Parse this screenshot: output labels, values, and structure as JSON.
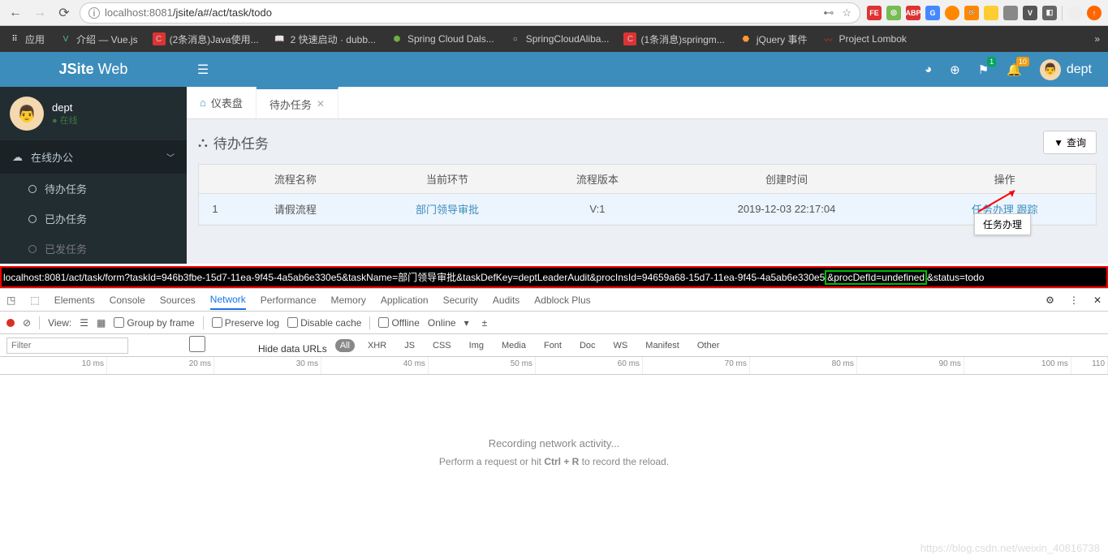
{
  "browser": {
    "url_host": "localhost",
    "url_port": ":8081",
    "url_path": "/jsite/a#/act/task/todo",
    "key_icon": "⊷",
    "star_icon": "☆"
  },
  "bookmarks": {
    "apps": "应用",
    "items": [
      {
        "label": "介绍 — Vue.js"
      },
      {
        "label": "(2条消息)Java使用..."
      },
      {
        "label": "2 快速启动 · dubb..."
      },
      {
        "label": "Spring Cloud Dals..."
      },
      {
        "label": "SpringCloudAliba..."
      },
      {
        "label": "(1条消息)springm..."
      },
      {
        "label": "jQuery 事件"
      },
      {
        "label": "Project Lombok"
      }
    ]
  },
  "app": {
    "logo_bold": "JSite",
    "logo_light": " Web",
    "badges": {
      "flag": "1",
      "bell": "10"
    },
    "user": "dept"
  },
  "sidebar": {
    "user": {
      "name": "dept",
      "status": "在线"
    },
    "menu_header": "在线办公",
    "items": [
      {
        "label": "待办任务"
      },
      {
        "label": "已办任务"
      },
      {
        "label": "已发任务"
      }
    ]
  },
  "tabs": {
    "dashboard": "仪表盘",
    "todo": "待办任务"
  },
  "page": {
    "title": "待办任务",
    "query_btn": "查询"
  },
  "table": {
    "headers": [
      "",
      "流程名称",
      "当前环节",
      "流程版本",
      "创建时间",
      "操作"
    ],
    "row": {
      "idx": "1",
      "name": "请假流程",
      "step": "部门领导审批",
      "ver": "V:1",
      "time": "2019-12-03 22:17:04",
      "op1": "任务办理",
      "op2": "跟踪"
    },
    "tooltip": "任务办理"
  },
  "highlight_url": {
    "part1": "localhost:8081/act/task/form?taskId=946b3fbe-15d7-11ea-9f45-4a5ab6e330e5&taskName=部门领导审批&taskDefKey=deptLeaderAudit&procInsId=94659a68-15d7-11ea-9f45-4a5ab6e330e5",
    "green": "&procDefId=undefined",
    "part2": "&status=todo"
  },
  "devtools": {
    "tabs": [
      "Elements",
      "Console",
      "Sources",
      "Network",
      "Performance",
      "Memory",
      "Application",
      "Security",
      "Audits",
      "Adblock Plus"
    ],
    "toolbar": {
      "view": "View:",
      "group": "Group by frame",
      "preserve": "Preserve log",
      "disable": "Disable cache",
      "offline": "Offline",
      "online": "Online"
    },
    "filter_placeholder": "Filter",
    "hide_urls": "Hide data URLs",
    "filter_pills": [
      "All",
      "XHR",
      "JS",
      "CSS",
      "Img",
      "Media",
      "Font",
      "Doc",
      "WS",
      "Manifest",
      "Other"
    ],
    "timeline": [
      "10 ms",
      "20 ms",
      "30 ms",
      "40 ms",
      "50 ms",
      "60 ms",
      "70 ms",
      "80 ms",
      "90 ms",
      "100 ms",
      "110"
    ],
    "recording": "Recording network activity...",
    "hint_pre": "Perform a request or hit ",
    "hint_key": "Ctrl + R",
    "hint_post": " to record the reload."
  },
  "watermark": "https://blog.csdn.net/weixin_40816738"
}
